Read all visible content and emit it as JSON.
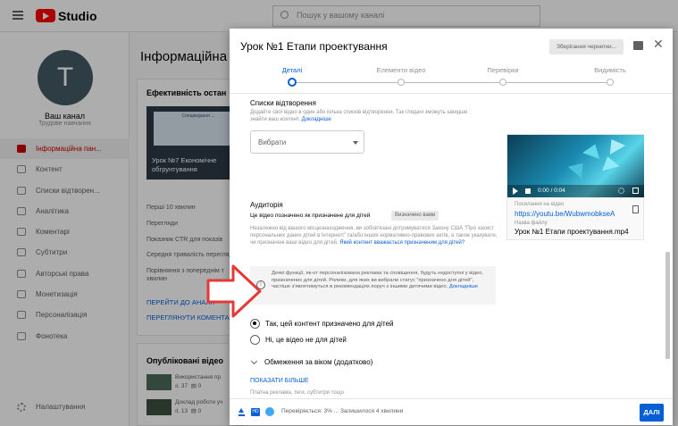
{
  "studio": {
    "logo_text": "Studio",
    "search_placeholder": "Пошук у вашому каналі",
    "channel": {
      "initial": "T",
      "name": "Ваш канал",
      "subtitle": "Трудове навчання"
    },
    "nav": [
      {
        "label": "Інформаційна пан...",
        "icon": "dashboard-icon",
        "active": true
      },
      {
        "label": "Контент",
        "icon": "content-icon",
        "active": false
      },
      {
        "label": "Списки відтворен...",
        "icon": "playlist-icon",
        "active": false
      },
      {
        "label": "Аналітика",
        "icon": "analytics-icon",
        "active": false
      },
      {
        "label": "Коментарі",
        "icon": "comments-icon",
        "active": false
      },
      {
        "label": "Субтитри",
        "icon": "subtitles-icon",
        "active": false
      },
      {
        "label": "Авторські права",
        "icon": "copyright-icon",
        "active": false
      },
      {
        "label": "Монетизація",
        "icon": "money-icon",
        "active": false
      },
      {
        "label": "Персоналізація",
        "icon": "magic-icon",
        "active": false
      },
      {
        "label": "Фонотека",
        "icon": "audio-library-icon",
        "active": false
      }
    ],
    "settings_label": "Налаштування",
    "main_title": "Інформаційна пан",
    "perf_card": {
      "title": "Ефективність остан",
      "thumb_top": "Спецвидання ...",
      "thumb_caption": "Урок №7 Економічне обгрунтування",
      "stats": [
        "Перші 10 хвилин",
        "Перегляди",
        "Показник CTR для показів",
        "Середня тривалість перегляд",
        "Порівняння з попереднім т",
        "хвилин"
      ],
      "link1": "ПЕРЕЙТИ ДО АНАЛІТ",
      "link2": "ПЕРЕГЛЯНУТИ КОМЕНТАР"
    },
    "published_card": {
      "title": "Опубліковані відео",
      "rows": [
        {
          "title": "Використання пр",
          "views": "37",
          "comments": "0"
        },
        {
          "title": "Доклад роботи уч",
          "views": "13",
          "comments": "0"
        }
      ]
    }
  },
  "dialog": {
    "title": "Урок №1 Етапи проектування",
    "draft_label": "Зберігання чернетки...",
    "steps": [
      "Деталі",
      "Елементи відео",
      "Перевірки",
      "Видимість"
    ],
    "playlists": {
      "title": "Списки відтворення",
      "desc": "Додайте свої відео в один або кілька списків відтворення. Так глядачі зможуть швидше знайти ваш контент.",
      "link": "Докладніше",
      "select_value": "Вибрати"
    },
    "audience": {
      "title": "Аудиторія",
      "subtitle": "Це відео позначено як призначене для дітей",
      "badge": "Визначено вами",
      "desc": "Незалежно від вашого місцезнаходження, ви зобов'язані дотримуватися Закону США \"Про захист персональних даних дітей в Інтернеті\" та/або інших нормативно-правових актів, а також указувати, чи призначені ваші відео для дітей.",
      "link": "Який контент вважається призначеним для дітей?",
      "info": "Деякі функції, як-от персоналізована реклама та сповіщення, будуть недоступні у відео, призначених для дітей. Ролики, для яких ви вибрали статус \"призначено для дітей\", частіше з'являтимуться в рекомендаціях поруч з іншими дитячими відео.",
      "info_link": "Докладніше",
      "option_yes": "Так, цей контент призначено для дітей",
      "option_no": "Ні, це відео не для дітей",
      "selected": "yes"
    },
    "age_restriction": "Обмеження за віком (додатково)",
    "show_more": "ПОКАЗАТИ БІЛЬШЕ",
    "show_more_sub": "Платна реклама, теги, субтитри тощо",
    "preview": {
      "time": "0:00 / 0:04",
      "link_label": "Посилання на відео",
      "link": "https://youtu.be/WubwmobkseA",
      "file_label": "Назва файлу",
      "file_name": "Урок №1 Етапи проектування.mp4"
    },
    "footer": {
      "hd_label": "HD",
      "status": "Перевіряється: 3% ... Залишилося 4 хвилини",
      "next": "ДАЛІ"
    }
  },
  "colors": {
    "accent": "#065fd4",
    "brand": "#ff0000",
    "arrow": "#e53935"
  }
}
